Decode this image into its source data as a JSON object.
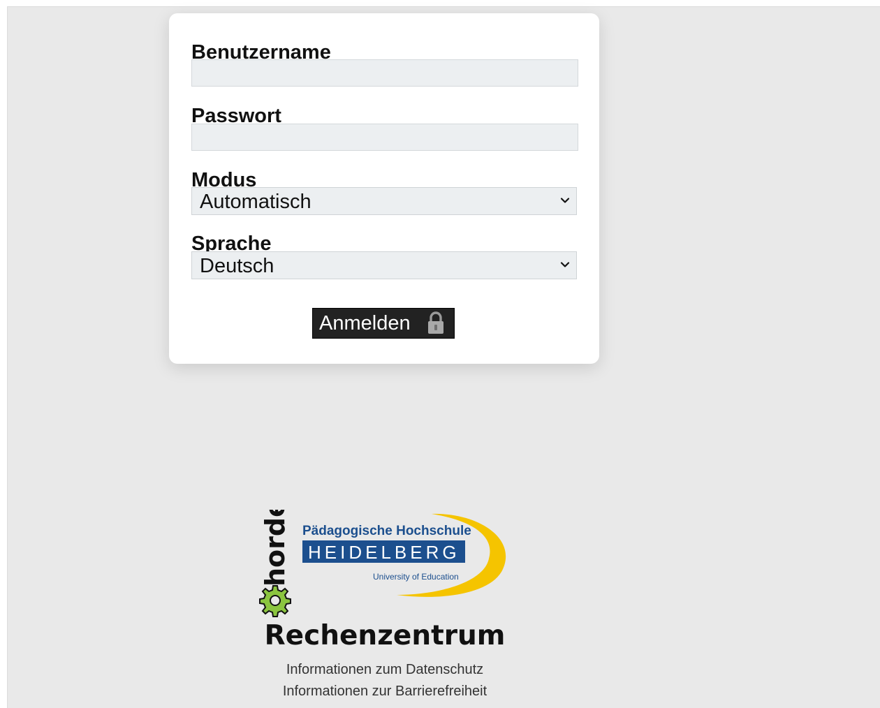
{
  "login_form": {
    "username_label": "Benutzername",
    "username_value": "",
    "password_label": "Passwort",
    "password_value": "",
    "mode_label": "Modus",
    "mode_value": "Automatisch",
    "language_label": "Sprache",
    "language_value": "Deutsch",
    "submit_label": "Anmelden"
  },
  "branding": {
    "horde_logo_text": "horde",
    "university_line1": "Pädagogische Hochschule",
    "university_line2": "HEIDELBERG",
    "university_line3": "University of Education",
    "title": "Rechenzentrum"
  },
  "footer": {
    "privacy_link": "Informationen zum Datenschutz",
    "accessibility_link": "Informationen zur Barrierefreiheit"
  },
  "icons": {
    "lock": "lock-icon",
    "chevron": "chevron-down-icon",
    "gear": "gear-icon"
  },
  "colors": {
    "page_background": "#e9e9e9",
    "button_background": "#222222",
    "horde_green": "#8bc53f",
    "ph_blue": "#1c4f8e",
    "ph_yellow": "#f5c400"
  }
}
